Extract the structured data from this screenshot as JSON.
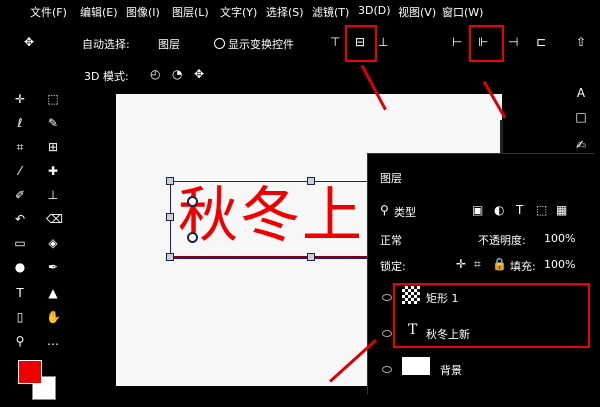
{
  "menu": {
    "items": [
      "文件(F)",
      "编辑(E)",
      "图像(I)",
      "图层(L)",
      "文字(Y)",
      "选择(S)",
      "滤镜(T)",
      "3D(D)",
      "视图(V)",
      "窗口(W)"
    ]
  },
  "options": {
    "auto_select_label": "自动选择:",
    "layer_select_value": "图层",
    "transform_controls_label": "显示变换控件",
    "mode_label": "3D 模式:"
  },
  "canvas": {
    "text": "秋冬上"
  },
  "layers_panel": {
    "title": "图层",
    "kind_label": "类型",
    "mode_label": "正常",
    "opacity_label": "不透明度:",
    "lock_label": "锁定:",
    "fill_label": "填充:",
    "opacity_value": "100%",
    "fill_value": "100%",
    "layers": [
      {
        "name": "矩形 1"
      },
      {
        "name": "秋冬上新"
      },
      {
        "name": "背景"
      }
    ]
  },
  "colors": {
    "foreground": "#ee0000",
    "background": "#ffffff",
    "highlight_box": "#ee0000"
  }
}
